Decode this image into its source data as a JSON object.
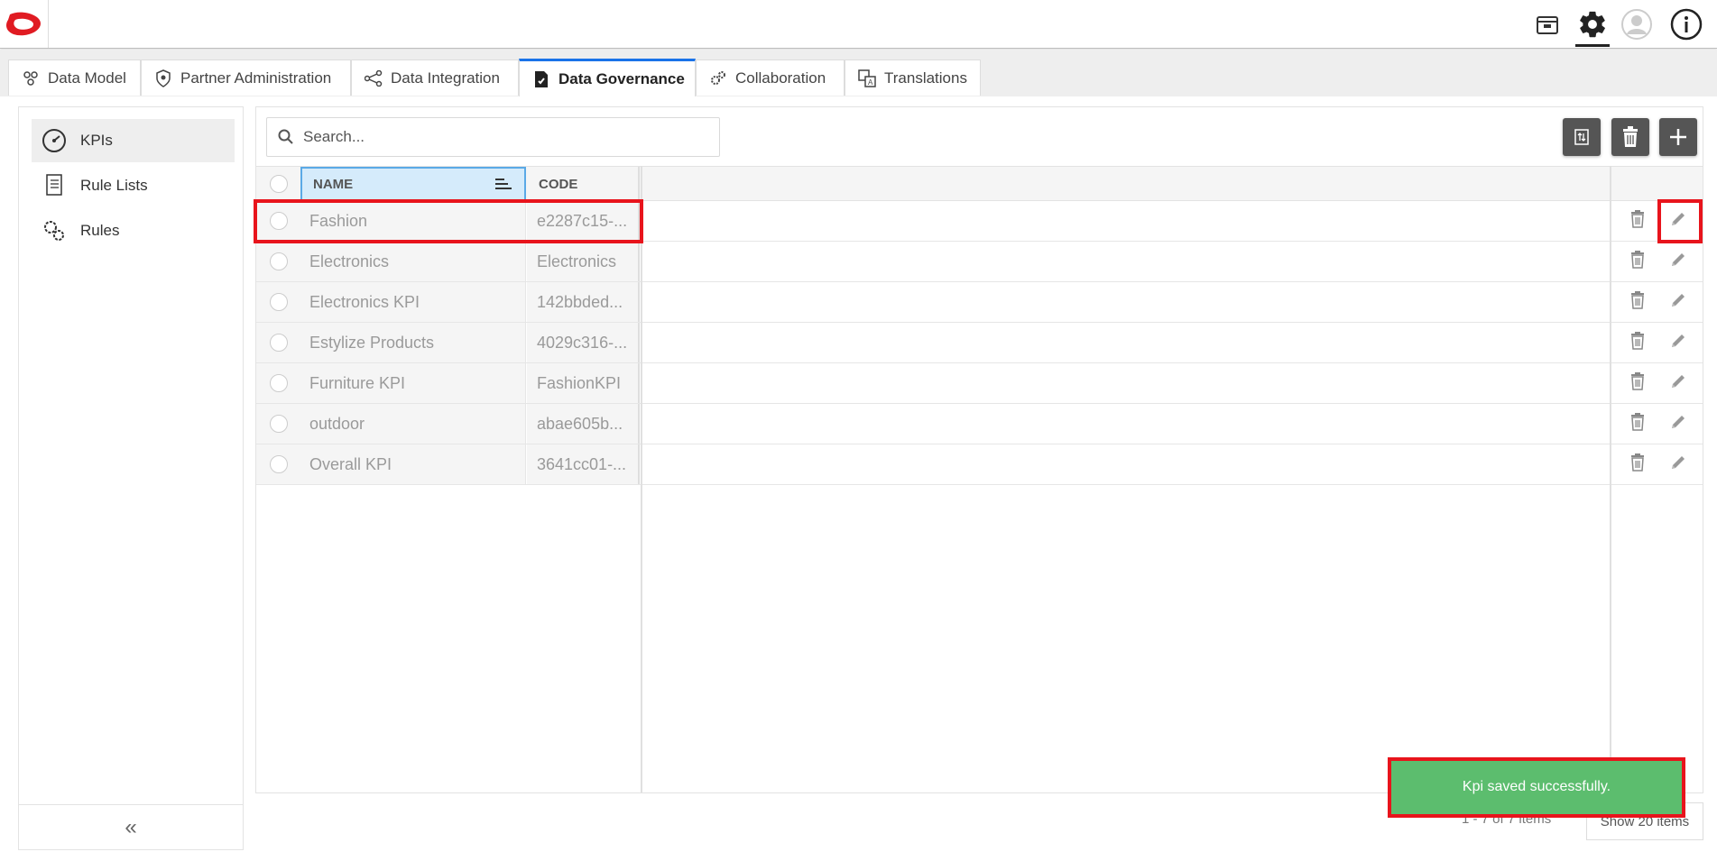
{
  "topbar": {
    "icons": [
      "package-icon",
      "gear-icon",
      "user-avatar-icon",
      "info-icon"
    ]
  },
  "tabs": [
    {
      "label": "Data Model",
      "icon": "data-model-icon"
    },
    {
      "label": "Partner Administration",
      "icon": "shield-icon"
    },
    {
      "label": "Data Integration",
      "icon": "nodes-icon"
    },
    {
      "label": "Data Governance",
      "icon": "governance-icon",
      "active": true
    },
    {
      "label": "Collaboration",
      "icon": "gears-icon"
    },
    {
      "label": "Translations",
      "icon": "translate-icon"
    }
  ],
  "sidebar": {
    "items": [
      {
        "label": "KPIs",
        "icon": "speedometer-icon",
        "active": true
      },
      {
        "label": "Rule Lists",
        "icon": "scroll-icon"
      },
      {
        "label": "Rules",
        "icon": "gears-icon"
      }
    ],
    "collapse_label": "«"
  },
  "search": {
    "placeholder": "Search..."
  },
  "grid": {
    "columns": {
      "name": "NAME",
      "code": "CODE"
    },
    "rows": [
      {
        "name": "Fashion",
        "code": "e2287c15-..."
      },
      {
        "name": "Electronics",
        "code": "Electronics"
      },
      {
        "name": "Electronics KPI",
        "code": "142bbded..."
      },
      {
        "name": "Estylize Products",
        "code": "4029c316-..."
      },
      {
        "name": "Furniture KPI",
        "code": "FashionKPI"
      },
      {
        "name": "outdoor",
        "code": "abae605b..."
      },
      {
        "name": "Overall KPI",
        "code": "3641cc01-..."
      }
    ]
  },
  "toast": {
    "message": "Kpi saved successfully."
  },
  "pager": {
    "info": "1 - 7 of 7 items",
    "page_size": "Show 20 items"
  },
  "colors": {
    "accent": "#1a73e8",
    "highlight": "#e8141c",
    "toast": "#5cbd6e",
    "toolbar_button": "#555555"
  }
}
